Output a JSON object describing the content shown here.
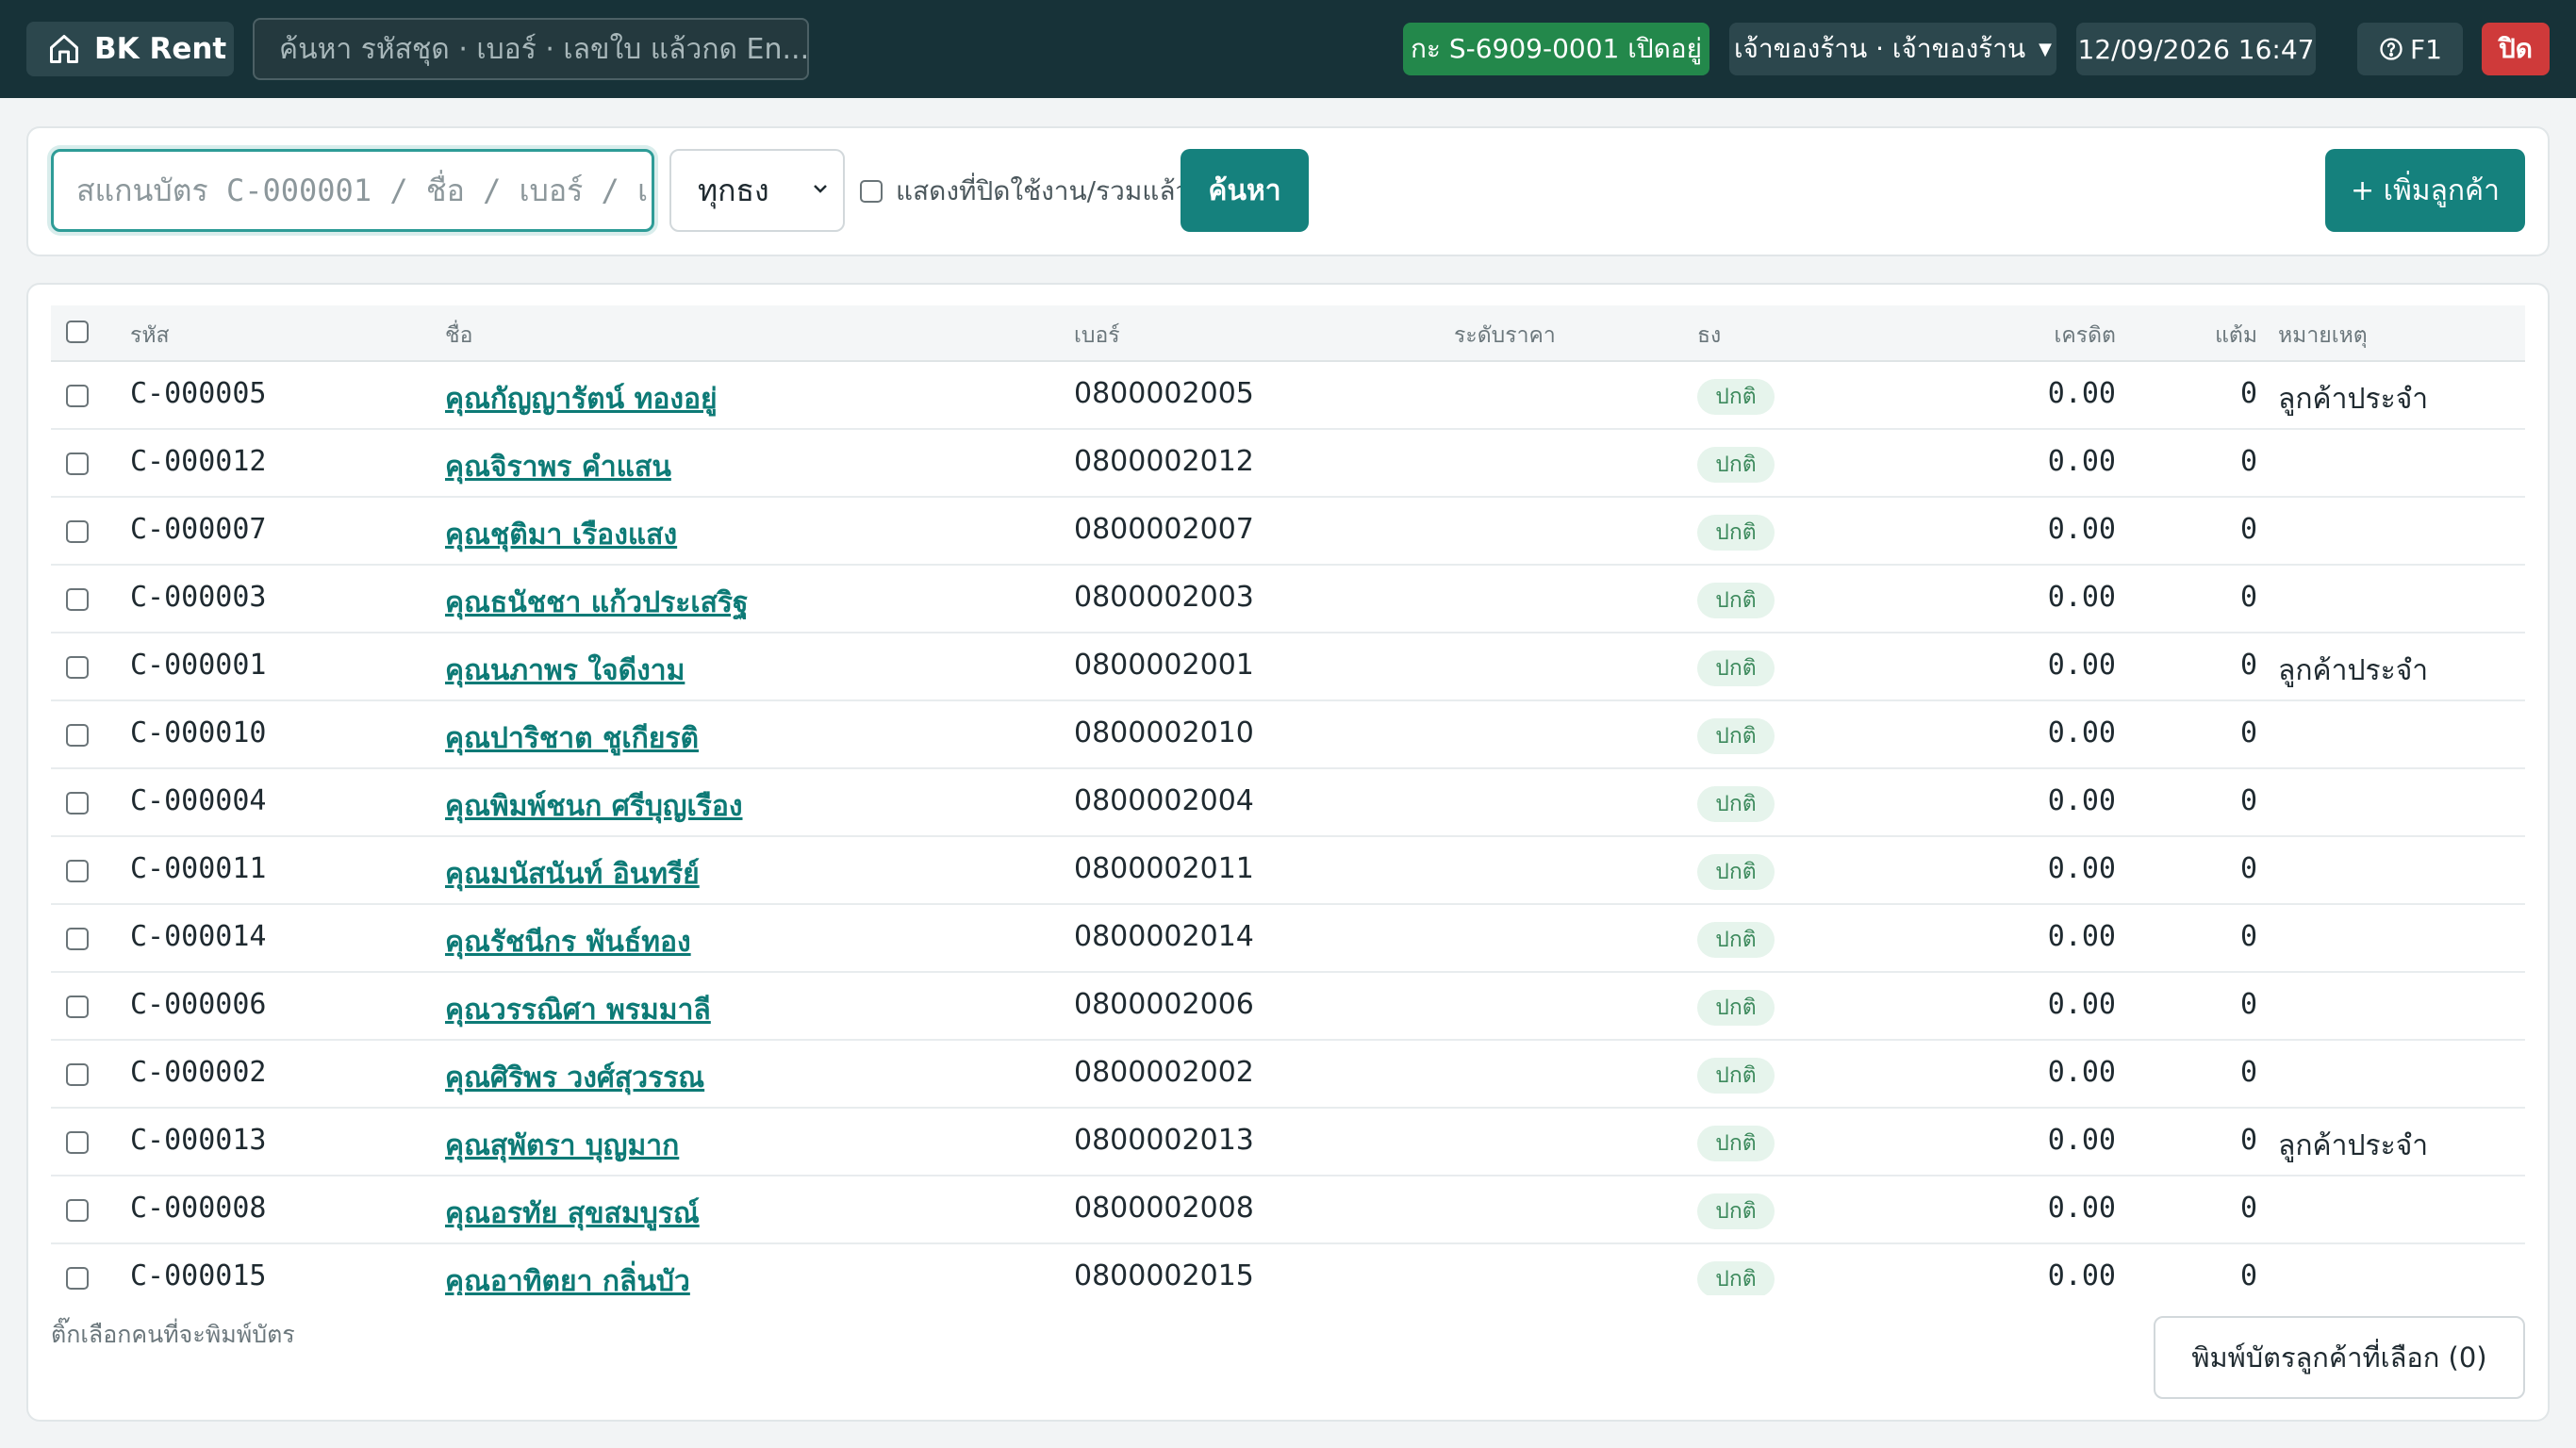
{
  "header": {
    "brand": "BK Rent",
    "search_placeholder": "ค้นหา รหัสชุด · เบอร์ · เลขใบ แล้วกด En...",
    "shift_status": "กะ S-6909-0001 เปิดอยู่",
    "user": "เจ้าของร้าน · เจ้าของร้าน",
    "datetime": "12/09/2026 16:47",
    "help": "F1",
    "close": "ปิด"
  },
  "filters": {
    "scan_placeholder": "สแกนบัตร C-000001 / ชื่อ / เบอร์ / เ",
    "group_selected": "ทุกธง",
    "show_closed_label": "แสดงที่ปิดใช้งาน/รวมแล้ว",
    "search_button": "ค้นหา",
    "add_button": "+ เพิ่มลูกค้า"
  },
  "table": {
    "headers": {
      "code": "รหัส",
      "name": "ชื่อ",
      "phone": "เบอร์",
      "price_level": "ระดับราคา",
      "flag": "ธง",
      "credit": "เครดิต",
      "points": "แต้ม",
      "note": "หมายเหตุ"
    },
    "rows": [
      {
        "code": "C-000005",
        "name": "คุณกัญญารัตน์ ทองอยู่",
        "phone": "0800002005",
        "flag": "ปกติ",
        "credit": "0.00",
        "points": "0",
        "note": "ลูกค้าประจำ"
      },
      {
        "code": "C-000012",
        "name": "คุณจิราพร คำแสน",
        "phone": "0800002012",
        "flag": "ปกติ",
        "credit": "0.00",
        "points": "0",
        "note": ""
      },
      {
        "code": "C-000007",
        "name": "คุณชุติมา เรืองแสง",
        "phone": "0800002007",
        "flag": "ปกติ",
        "credit": "0.00",
        "points": "0",
        "note": ""
      },
      {
        "code": "C-000003",
        "name": "คุณธนัชชา แก้วประเสริฐ",
        "phone": "0800002003",
        "flag": "ปกติ",
        "credit": "0.00",
        "points": "0",
        "note": ""
      },
      {
        "code": "C-000001",
        "name": "คุณนภาพร ใจดีงาม",
        "phone": "0800002001",
        "flag": "ปกติ",
        "credit": "0.00",
        "points": "0",
        "note": "ลูกค้าประจำ"
      },
      {
        "code": "C-000010",
        "name": "คุณปาริชาต ชูเกียรติ",
        "phone": "0800002010",
        "flag": "ปกติ",
        "credit": "0.00",
        "points": "0",
        "note": ""
      },
      {
        "code": "C-000004",
        "name": "คุณพิมพ์ชนก ศรีบุญเรือง",
        "phone": "0800002004",
        "flag": "ปกติ",
        "credit": "0.00",
        "points": "0",
        "note": ""
      },
      {
        "code": "C-000011",
        "name": "คุณมนัสนันท์ อินทรีย์",
        "phone": "0800002011",
        "flag": "ปกติ",
        "credit": "0.00",
        "points": "0",
        "note": ""
      },
      {
        "code": "C-000014",
        "name": "คุณรัชนีกร พันธ์ทอง",
        "phone": "0800002014",
        "flag": "ปกติ",
        "credit": "0.00",
        "points": "0",
        "note": ""
      },
      {
        "code": "C-000006",
        "name": "คุณวรรณิศา พรมมาลี",
        "phone": "0800002006",
        "flag": "ปกติ",
        "credit": "0.00",
        "points": "0",
        "note": ""
      },
      {
        "code": "C-000002",
        "name": "คุณศิริพร วงศ์สุวรรณ",
        "phone": "0800002002",
        "flag": "ปกติ",
        "credit": "0.00",
        "points": "0",
        "note": ""
      },
      {
        "code": "C-000013",
        "name": "คุณสุพัตรา บุญมาก",
        "phone": "0800002013",
        "flag": "ปกติ",
        "credit": "0.00",
        "points": "0",
        "note": "ลูกค้าประจำ"
      },
      {
        "code": "C-000008",
        "name": "คุณอรทัย สุขสมบูรณ์",
        "phone": "0800002008",
        "flag": "ปกติ",
        "credit": "0.00",
        "points": "0",
        "note": ""
      },
      {
        "code": "C-000015",
        "name": "คุณอาทิตยา กลิ่นบัว",
        "phone": "0800002015",
        "flag": "ปกติ",
        "credit": "0.00",
        "points": "0",
        "note": ""
      }
    ]
  },
  "footer": {
    "hint": "ติ๊กเลือกคนที่จะพิมพ์บัตร",
    "print_button": "พิมพ์บัตรลูกค้าที่เลือก (0)"
  }
}
